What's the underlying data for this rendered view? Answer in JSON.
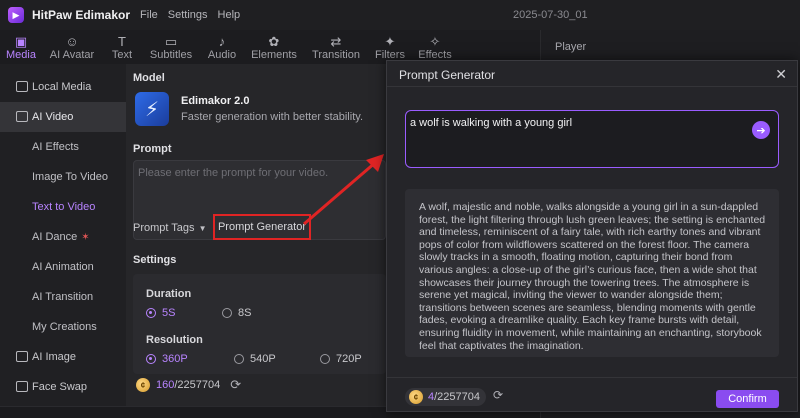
{
  "app": {
    "name": "HitPaw Edimakor",
    "menu": [
      "File",
      "Settings",
      "Help"
    ],
    "project_title": "2025-07-30_01"
  },
  "tool_tabs": [
    {
      "label": "Media",
      "icon": "media-icon",
      "active": true
    },
    {
      "label": "AI Avatar",
      "icon": "avatar-icon",
      "active": false
    },
    {
      "label": "Text",
      "icon": "text-icon",
      "active": false
    },
    {
      "label": "Subtitles",
      "icon": "subtitles-icon",
      "active": false
    },
    {
      "label": "Audio",
      "icon": "music-note-icon",
      "active": false
    },
    {
      "label": "Elements",
      "icon": "elements-icon",
      "active": false
    },
    {
      "label": "Transition",
      "icon": "transition-icon",
      "active": false
    },
    {
      "label": "Filters",
      "icon": "sparkle-icon",
      "active": false
    },
    {
      "label": "Effects",
      "icon": "effects-icon",
      "active": false
    }
  ],
  "sidebar": {
    "items": [
      {
        "label": "Local Media",
        "type": "top"
      },
      {
        "label": "AI Video",
        "type": "top",
        "active": true
      },
      {
        "label": "AI Effects",
        "type": "sub"
      },
      {
        "label": "Image To Video",
        "type": "sub"
      },
      {
        "label": "Text to Video",
        "type": "sub",
        "selected": true
      },
      {
        "label": "AI Dance",
        "type": "sub"
      },
      {
        "label": "AI Animation",
        "type": "sub"
      },
      {
        "label": "AI Transition",
        "type": "sub"
      },
      {
        "label": "My Creations",
        "type": "sub"
      },
      {
        "label": "AI Image",
        "type": "top"
      },
      {
        "label": "Face Swap",
        "type": "top"
      }
    ]
  },
  "panel": {
    "model_heading": "Model",
    "model_name": "Edimakor 2.0",
    "model_desc": "Faster generation with better stability.",
    "prompt_heading": "Prompt",
    "prompt_placeholder": "Please enter the prompt for your video.",
    "prompt_tags_label": "Prompt Tags",
    "prompt_generator_label": "Prompt Generator",
    "settings_heading": "Settings",
    "duration_heading": "Duration",
    "duration_options": [
      {
        "label": "5S",
        "selected": true
      },
      {
        "label": "8S",
        "selected": false
      }
    ],
    "resolution_heading": "Resolution",
    "resolution_options": [
      {
        "label": "360P",
        "selected": true
      },
      {
        "label": "540P",
        "selected": false
      },
      {
        "label": "720P",
        "selected": false
      }
    ],
    "credits_used": "160",
    "credits_total": "/2257704"
  },
  "player": {
    "label": "Player"
  },
  "dialog": {
    "title": "Prompt Generator",
    "input_value": "a wolf is walking with a young girl",
    "result_text": "A wolf, majestic and noble, walks alongside a young girl in a sun-dappled forest, the light filtering through lush green leaves; the setting is enchanted and timeless, reminiscent of a fairy tale, with rich earthy tones and vibrant pops of color from wildflowers scattered on the forest floor. The camera slowly tracks in a smooth, floating motion, capturing their bond from various angles: a close-up of the girl’s curious face, then a wide shot that showcases their journey through the towering trees. The atmosphere is serene yet magical, inviting the viewer to wander alongside them; transitions between scenes are seamless, blending moments with gentle fades, evoking a dreamlike quality. Each key frame bursts with detail, ensuring fluidity in movement, while maintaining an enchanting, storybook feel that captivates the imagination.",
    "credits_used": "4",
    "credits_total": "/2257704",
    "confirm_label": "Confirm"
  },
  "colors": {
    "accent": "#b884ff",
    "annotation_red": "#e02424",
    "confirm_bg": "#8a4cf0"
  }
}
